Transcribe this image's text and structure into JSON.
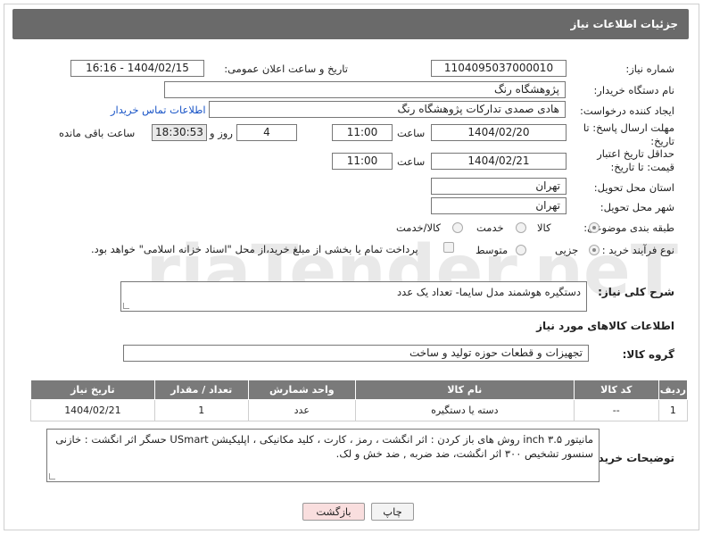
{
  "header": {
    "title": "جزئیات اطلاعات نیاز"
  },
  "labels": {
    "need_number": "شماره نیاز:",
    "announce_datetime": "تاریخ و ساعت اعلان عمومی:",
    "buyer_org": "نام دستگاه خریدار:",
    "requester": "ایجاد کننده درخواست:",
    "reply_deadline": "مهلت ارسال پاسخ: تا تاریخ:",
    "time_word": "ساعت",
    "day_word": "روز و",
    "remaining": "ساعت باقی مانده",
    "price_validity": "حداقل تاریخ اعتبار قیمت: تا تاریخ:",
    "province": "استان محل تحویل:",
    "city": "شهر محل تحویل:",
    "category": "طبقه بندی موضوعی:",
    "purchase_type": "نوع فرآیند خرید :",
    "description": "شرح کلی نیاز:",
    "goods_info": "اطلاعات کالاهای مورد نیاز",
    "goods_group": "گروه کالا:",
    "buyer_notes": "توضیحات خریدار:"
  },
  "values": {
    "need_number": "1104095037000010",
    "announce_datetime": "1404/02/15 - 16:16",
    "buyer_org": "پژوهشگاه رنگ",
    "requester": "هادی صمدی تدارکات پژوهشگاه رنگ",
    "contact_link": "اطلاعات تماس خریدار",
    "reply_date": "1404/02/20",
    "reply_time": "11:00",
    "days": "4",
    "remaining_time": "18:30:53",
    "price_date": "1404/02/21",
    "price_time": "11:00",
    "province": "تهران",
    "city": "تهران",
    "description": "دستگیره هوشمند مدل سایما- تعداد یک عدد",
    "goods_group": "تجهیزات و قطعات حوزه تولید و ساخت",
    "buyer_notes": "مانیتور ۳.۵ inch روش های باز کردن : اثر انگشت ، رمز ، کارت ، کلید مکانیکی ، اپلیکیشن USmart حسگر اثر انگشت : خازنی سنسور تشخیص ۳۰۰ اثر انگشت، ضد ضربه , ضد خش و لک."
  },
  "category_options": {
    "goods": "کالا",
    "service": "خدمت",
    "goods_service": "کالا/خدمت"
  },
  "purchase_options": {
    "minor": "جزیی",
    "medium": "متوسط",
    "treasury_note": "پرداخت تمام یا بخشی از مبلغ خرید،از محل \"اسناد خزانه اسلامی\" خواهد بود."
  },
  "table": {
    "headers": [
      "ردیف",
      "کد کالا",
      "نام کالا",
      "واحد شمارش",
      "تعداد / مقدار",
      "تاریخ نیاز"
    ],
    "rows": [
      [
        "1",
        "--",
        "دسته یا دستگیره",
        "عدد",
        "1",
        "1404/02/21"
      ]
    ]
  },
  "buttons": {
    "print": "چاپ",
    "back": "بازگشت"
  },
  "watermark": "AriaTender.neT"
}
